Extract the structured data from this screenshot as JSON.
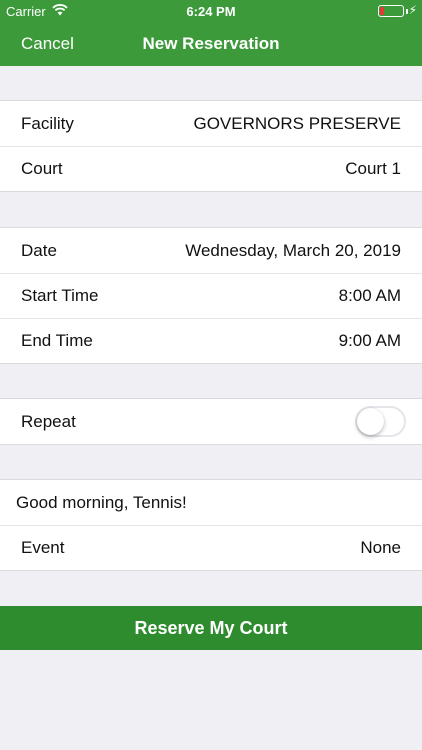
{
  "status_bar": {
    "carrier": "Carrier",
    "time": "6:24 PM",
    "wifi_icon": "wifi-icon",
    "battery_icon": "battery-icon",
    "charging_icon": "bolt-icon",
    "charging_glyph": "⚡"
  },
  "nav": {
    "cancel_label": "Cancel",
    "title": "New Reservation"
  },
  "location": {
    "facility_label": "Facility",
    "facility_value": "GOVERNORS PRESERVE",
    "court_label": "Court",
    "court_value": "Court 1"
  },
  "schedule": {
    "date_label": "Date",
    "date_value": "Wednesday, March 20, 2019",
    "start_label": "Start Time",
    "start_value": "8:00 AM",
    "end_label": "End Time",
    "end_value": "9:00 AM"
  },
  "repeat": {
    "label": "Repeat",
    "enabled": false
  },
  "details": {
    "greeting": "Good morning, Tennis!",
    "event_label": "Event",
    "event_value": "None"
  },
  "actions": {
    "reserve_label": "Reserve My Court"
  },
  "colors": {
    "header": "#3c9a3b",
    "button": "#2e8b2e",
    "background": "#efeff4"
  }
}
